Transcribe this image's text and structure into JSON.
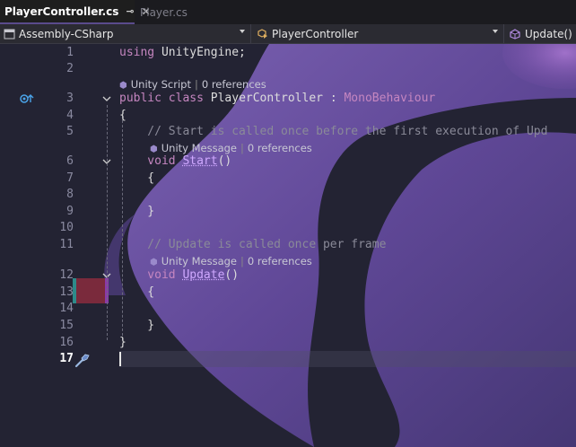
{
  "tabs": [
    {
      "label": "PlayerController.cs",
      "active": true
    },
    {
      "label": "Player.cs",
      "active": false
    }
  ],
  "nav": {
    "project": "Assembly-CSharp",
    "class": "PlayerController",
    "member": "Update()"
  },
  "code": {
    "line1_kw": "using",
    "line1_rest": " UnityEngine;",
    "hint3_a": "Unity Script",
    "hint3_b": "0 references",
    "line3_kw1": "public",
    "line3_kw2": "class",
    "line3_rest": " PlayerController : ",
    "line3_base": "MonoBehaviour",
    "line4": "{",
    "line5": "    // Start is called once before the first execution of Upd",
    "hint6_a": "Unity Message",
    "hint6_b": "0 references",
    "line6_kw": "    void",
    "line6_fn": "Start",
    "line6_rest": "()",
    "line7": "    {",
    "line9": "    }",
    "line11": "    // Update is called once per frame",
    "hint12_a": "Unity Message",
    "hint12_b": "0 references",
    "line12_kw": "    void",
    "line12_fn": "Update",
    "line12_rest": "()",
    "line13": "    {",
    "line15": "    }",
    "line16": "}"
  },
  "line_numbers": [
    "1",
    "2",
    "3",
    "4",
    "5",
    "6",
    "7",
    "8",
    "9",
    "10",
    "11",
    "12",
    "13",
    "14",
    "15",
    "16",
    "17"
  ],
  "icons": {
    "tab_pin": "pin-icon",
    "tab_close": "close-icon",
    "project": "csharp-project-icon",
    "class": "class-icon",
    "member": "method-icon",
    "line3_marker": "unity-implementation-icon",
    "line17_marker": "quick-actions-screwdriver-icon"
  },
  "colors": {
    "keyword": "#c586c0",
    "comment": "#8a8a98",
    "background": "#232333",
    "accent": "#7a5cc4"
  }
}
